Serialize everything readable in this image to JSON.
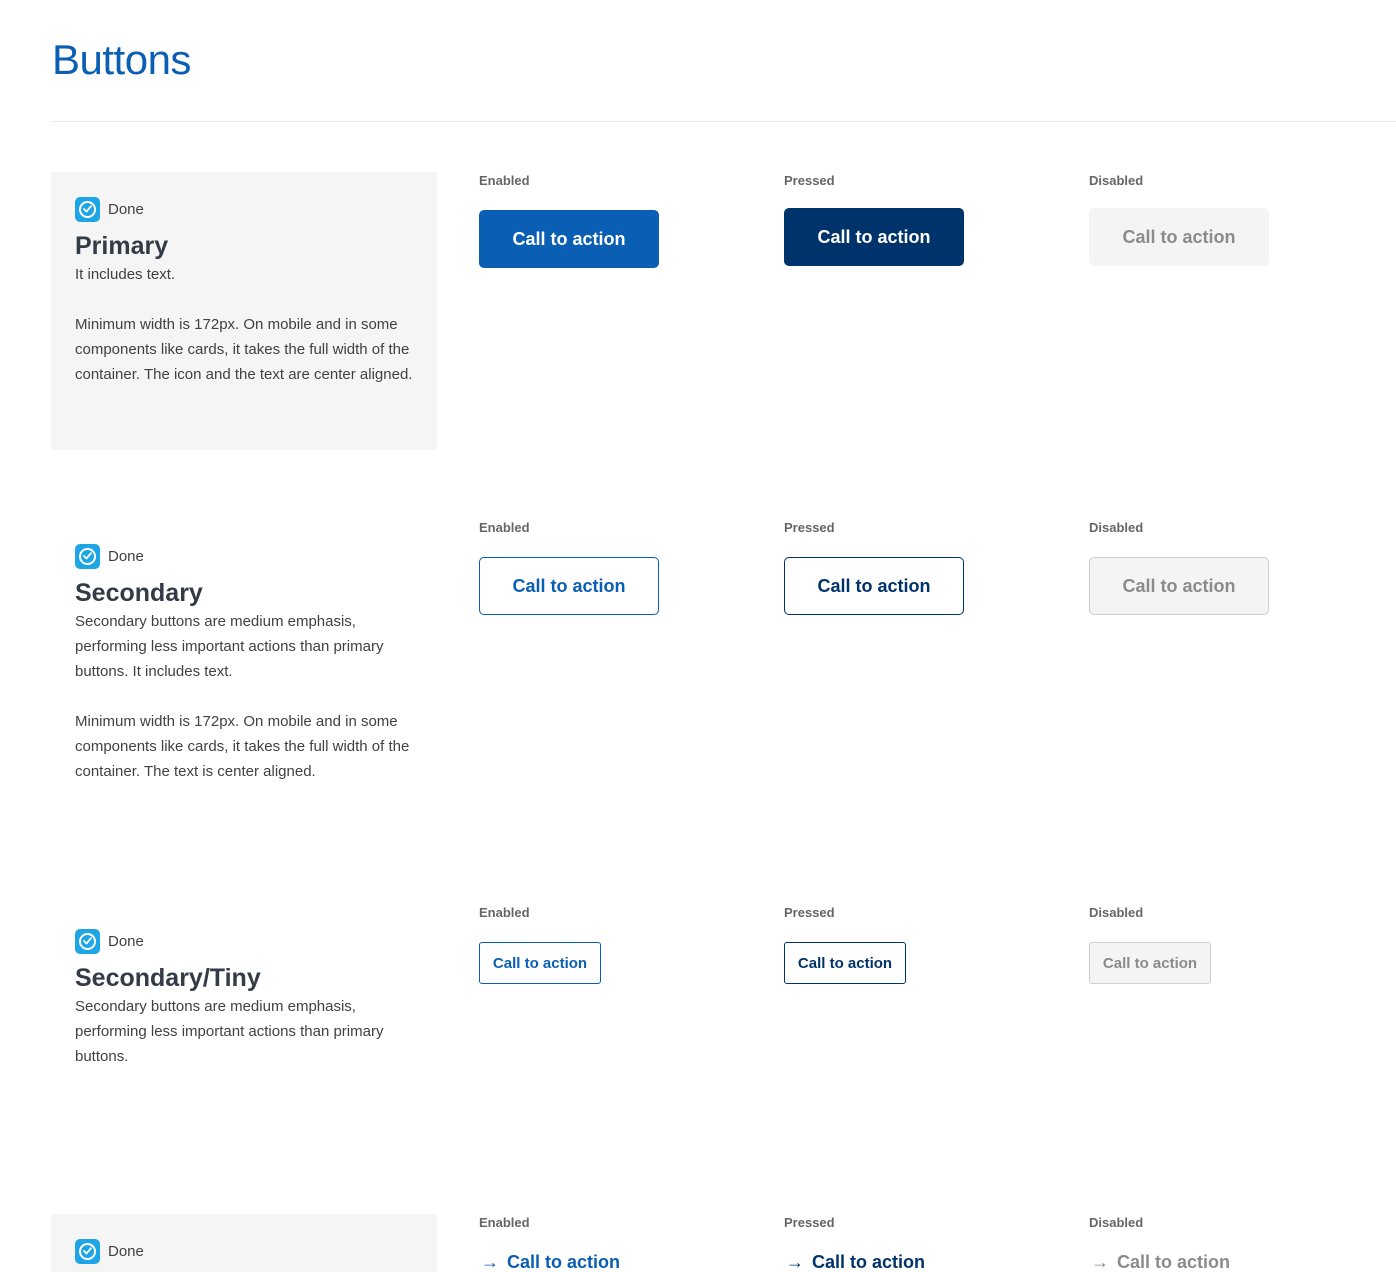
{
  "page": {
    "title": "Buttons"
  },
  "states": {
    "enabled": "Enabled",
    "pressed": "Pressed",
    "disabled": "Disabled"
  },
  "sections": {
    "primary": {
      "status": "Done",
      "title": "Primary",
      "desc1": "It includes text.",
      "desc2": "Minimum width is 172px. On mobile and in some components like cards, it takes the full width of the container. The icon and the text are center aligned.",
      "button_label": "Call to action"
    },
    "secondary": {
      "status": "Done",
      "title": "Secondary",
      "desc1": "Secondary buttons are medium emphasis, performing less important actions than primary buttons. It includes text.",
      "desc2": "Minimum width is 172px. On mobile and in some components like cards, it takes the full width of the container. The text is center aligned.",
      "button_label": "Call to action"
    },
    "secondary_tiny": {
      "status": "Done",
      "title": "Secondary/Tiny",
      "desc1": "Secondary buttons are medium emphasis, performing less important actions than primary buttons.",
      "button_label": "Call to action"
    },
    "link": {
      "status": "Done",
      "button_label": "Call to action",
      "arrow_icon": "arrow-right-icon"
    }
  },
  "colors": {
    "brand_blue": "#0a5fb4",
    "brand_dark": "#00336b",
    "status_check": "#1da5e6",
    "disabled_bg": "#f4f4f4",
    "disabled_text": "#8b8b8b"
  }
}
